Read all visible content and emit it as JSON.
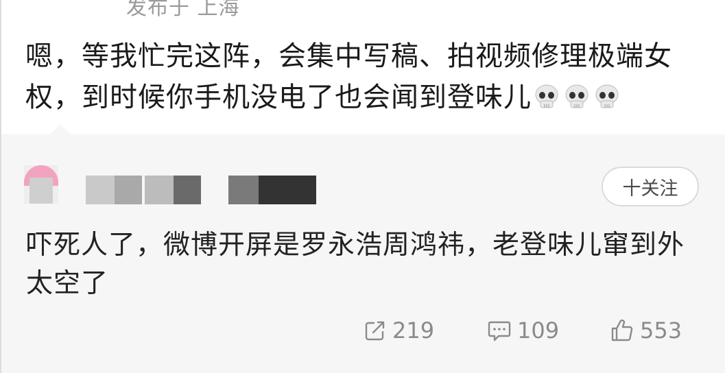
{
  "post": {
    "location": "发布于 上海",
    "text": "嗯，等我忙完这阵，会集中写稿、拍视频修理极端女权，到时候你手机没电了也会闻到登味儿",
    "emoji": [
      "skull-emoji",
      "skull-emoji",
      "skull-emoji"
    ]
  },
  "comment": {
    "follow_label": "十关注",
    "text": "吓死人了，微博开屏是罗永浩周鸿祎，老登味儿窜到外太空了"
  },
  "actions": {
    "repost_count": "219",
    "comment_count": "109",
    "like_count": "553"
  },
  "colors": {
    "comment_bg": "#f6f6f6",
    "muted_text": "#8a8a8a",
    "avatar_accent": "#f2a3c0"
  }
}
